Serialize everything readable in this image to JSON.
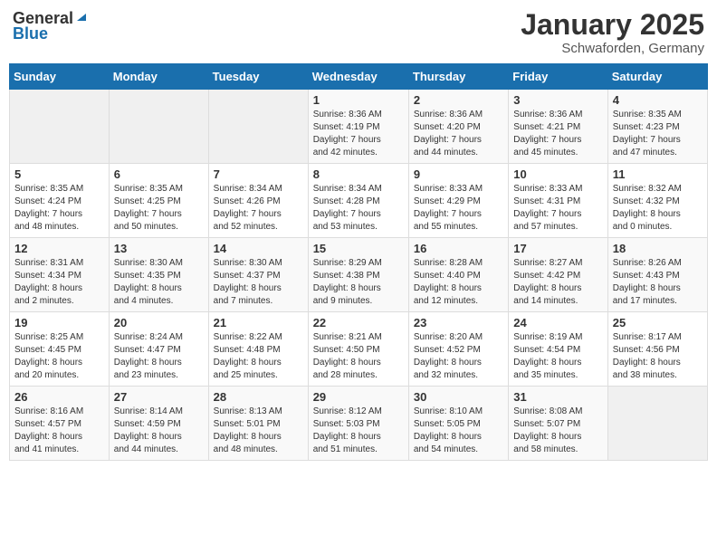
{
  "header": {
    "logo_general": "General",
    "logo_blue": "Blue",
    "month": "January 2025",
    "location": "Schwaforden, Germany"
  },
  "weekdays": [
    "Sunday",
    "Monday",
    "Tuesday",
    "Wednesday",
    "Thursday",
    "Friday",
    "Saturday"
  ],
  "weeks": [
    [
      {
        "day": "",
        "info": ""
      },
      {
        "day": "",
        "info": ""
      },
      {
        "day": "",
        "info": ""
      },
      {
        "day": "1",
        "info": "Sunrise: 8:36 AM\nSunset: 4:19 PM\nDaylight: 7 hours\nand 42 minutes."
      },
      {
        "day": "2",
        "info": "Sunrise: 8:36 AM\nSunset: 4:20 PM\nDaylight: 7 hours\nand 44 minutes."
      },
      {
        "day": "3",
        "info": "Sunrise: 8:36 AM\nSunset: 4:21 PM\nDaylight: 7 hours\nand 45 minutes."
      },
      {
        "day": "4",
        "info": "Sunrise: 8:35 AM\nSunset: 4:23 PM\nDaylight: 7 hours\nand 47 minutes."
      }
    ],
    [
      {
        "day": "5",
        "info": "Sunrise: 8:35 AM\nSunset: 4:24 PM\nDaylight: 7 hours\nand 48 minutes."
      },
      {
        "day": "6",
        "info": "Sunrise: 8:35 AM\nSunset: 4:25 PM\nDaylight: 7 hours\nand 50 minutes."
      },
      {
        "day": "7",
        "info": "Sunrise: 8:34 AM\nSunset: 4:26 PM\nDaylight: 7 hours\nand 52 minutes."
      },
      {
        "day": "8",
        "info": "Sunrise: 8:34 AM\nSunset: 4:28 PM\nDaylight: 7 hours\nand 53 minutes."
      },
      {
        "day": "9",
        "info": "Sunrise: 8:33 AM\nSunset: 4:29 PM\nDaylight: 7 hours\nand 55 minutes."
      },
      {
        "day": "10",
        "info": "Sunrise: 8:33 AM\nSunset: 4:31 PM\nDaylight: 7 hours\nand 57 minutes."
      },
      {
        "day": "11",
        "info": "Sunrise: 8:32 AM\nSunset: 4:32 PM\nDaylight: 8 hours\nand 0 minutes."
      }
    ],
    [
      {
        "day": "12",
        "info": "Sunrise: 8:31 AM\nSunset: 4:34 PM\nDaylight: 8 hours\nand 2 minutes."
      },
      {
        "day": "13",
        "info": "Sunrise: 8:30 AM\nSunset: 4:35 PM\nDaylight: 8 hours\nand 4 minutes."
      },
      {
        "day": "14",
        "info": "Sunrise: 8:30 AM\nSunset: 4:37 PM\nDaylight: 8 hours\nand 7 minutes."
      },
      {
        "day": "15",
        "info": "Sunrise: 8:29 AM\nSunset: 4:38 PM\nDaylight: 8 hours\nand 9 minutes."
      },
      {
        "day": "16",
        "info": "Sunrise: 8:28 AM\nSunset: 4:40 PM\nDaylight: 8 hours\nand 12 minutes."
      },
      {
        "day": "17",
        "info": "Sunrise: 8:27 AM\nSunset: 4:42 PM\nDaylight: 8 hours\nand 14 minutes."
      },
      {
        "day": "18",
        "info": "Sunrise: 8:26 AM\nSunset: 4:43 PM\nDaylight: 8 hours\nand 17 minutes."
      }
    ],
    [
      {
        "day": "19",
        "info": "Sunrise: 8:25 AM\nSunset: 4:45 PM\nDaylight: 8 hours\nand 20 minutes."
      },
      {
        "day": "20",
        "info": "Sunrise: 8:24 AM\nSunset: 4:47 PM\nDaylight: 8 hours\nand 23 minutes."
      },
      {
        "day": "21",
        "info": "Sunrise: 8:22 AM\nSunset: 4:48 PM\nDaylight: 8 hours\nand 25 minutes."
      },
      {
        "day": "22",
        "info": "Sunrise: 8:21 AM\nSunset: 4:50 PM\nDaylight: 8 hours\nand 28 minutes."
      },
      {
        "day": "23",
        "info": "Sunrise: 8:20 AM\nSunset: 4:52 PM\nDaylight: 8 hours\nand 32 minutes."
      },
      {
        "day": "24",
        "info": "Sunrise: 8:19 AM\nSunset: 4:54 PM\nDaylight: 8 hours\nand 35 minutes."
      },
      {
        "day": "25",
        "info": "Sunrise: 8:17 AM\nSunset: 4:56 PM\nDaylight: 8 hours\nand 38 minutes."
      }
    ],
    [
      {
        "day": "26",
        "info": "Sunrise: 8:16 AM\nSunset: 4:57 PM\nDaylight: 8 hours\nand 41 minutes."
      },
      {
        "day": "27",
        "info": "Sunrise: 8:14 AM\nSunset: 4:59 PM\nDaylight: 8 hours\nand 44 minutes."
      },
      {
        "day": "28",
        "info": "Sunrise: 8:13 AM\nSunset: 5:01 PM\nDaylight: 8 hours\nand 48 minutes."
      },
      {
        "day": "29",
        "info": "Sunrise: 8:12 AM\nSunset: 5:03 PM\nDaylight: 8 hours\nand 51 minutes."
      },
      {
        "day": "30",
        "info": "Sunrise: 8:10 AM\nSunset: 5:05 PM\nDaylight: 8 hours\nand 54 minutes."
      },
      {
        "day": "31",
        "info": "Sunrise: 8:08 AM\nSunset: 5:07 PM\nDaylight: 8 hours\nand 58 minutes."
      },
      {
        "day": "",
        "info": ""
      }
    ]
  ]
}
